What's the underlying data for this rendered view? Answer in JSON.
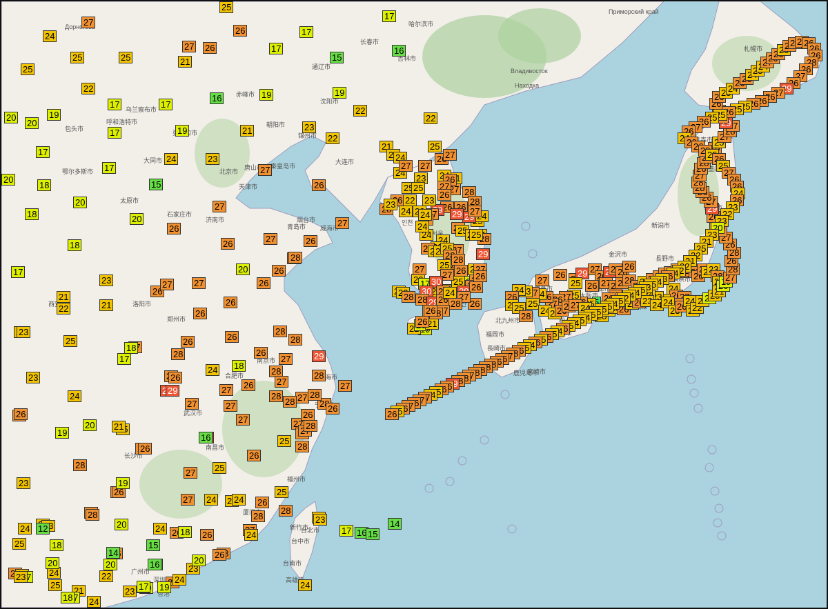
{
  "map": {
    "colors": {
      "sea": "#aad3df",
      "land": "#f2efe9",
      "forest": "#add19e",
      "border": "#9e9cbf"
    },
    "place_labels": [
      "Дорноговь",
      "乌兰察布市",
      "呼和浩特市",
      "包头市",
      "鄂尔多斯市",
      "大同市",
      "张家口市",
      "北京市",
      "天津市",
      "唐山市",
      "秦皇岛市",
      "石家庄市",
      "太原市",
      "济南市",
      "青岛市",
      "威海市",
      "烟台市",
      "沈阳市",
      "大连市",
      "长春市",
      "哈尔滨市",
      "吉林市",
      "通辽市",
      "赤峰市",
      "朝阳市",
      "锦州市",
      "郑州市",
      "洛阳市",
      "西安市",
      "武汉市",
      "南京市",
      "上海市",
      "杭州市",
      "宁波市",
      "合肥市",
      "南昌市",
      "长沙市",
      "福州市",
      "厦门市",
      "广州市",
      "深圳市",
      "香港",
      "台北市",
      "台中市",
      "高雄市",
      "台南市",
      "新竹市",
      "平壤",
      "서울",
      "부산",
      "대구",
      "광주",
      "인천",
      "제주",
      "Владивосток",
      "Находка",
      "Приморский край",
      "福岡市",
      "北九州市",
      "広島市",
      "大阪市",
      "京都市",
      "名古屋市",
      "東京",
      "横浜市",
      "仙台市",
      "札幌市",
      "新潟市",
      "金沢市",
      "長野市",
      "静岡市",
      "浜松市",
      "松山市",
      "高知市",
      "鹿児島市",
      "長崎市",
      "熊本市",
      "宮崎市",
      "青森市",
      "盛岡市"
    ],
    "temperatures": [
      {
        "v": "14"
      },
      {
        "v": "19"
      },
      {
        "v": "19"
      },
      {
        "v": "22"
      },
      {
        "v": "22"
      },
      {
        "v": "20"
      },
      {
        "v": "21"
      },
      {
        "v": "16"
      },
      {
        "v": "17"
      },
      {
        "v": "17"
      },
      {
        "v": "17"
      },
      {
        "v": "15"
      },
      {
        "v": "17"
      },
      {
        "v": "17"
      },
      {
        "v": "16"
      },
      {
        "v": "19"
      },
      {
        "v": "19"
      },
      {
        "v": "20"
      },
      {
        "v": "19"
      },
      {
        "v": "17"
      },
      {
        "v": "21"
      },
      {
        "v": "23"
      },
      {
        "v": "22"
      },
      {
        "v": "22"
      },
      {
        "v": "16"
      },
      {
        "v": "21"
      },
      {
        "v": "20"
      },
      {
        "v": "17"
      },
      {
        "v": "19"
      },
      {
        "v": "22"
      },
      {
        "v": "24"
      },
      {
        "v": "17"
      },
      {
        "v": "20"
      },
      {
        "v": "18"
      },
      {
        "v": "17"
      },
      {
        "v": "15"
      },
      {
        "v": "23"
      },
      {
        "v": "27"
      },
      {
        "v": "26"
      },
      {
        "v": "21"
      },
      {
        "v": "20"
      },
      {
        "v": "18"
      },
      {
        "v": "17"
      },
      {
        "v": "18"
      },
      {
        "v": "20"
      },
      {
        "v": "26"
      },
      {
        "v": "27"
      },
      {
        "v": "26"
      },
      {
        "v": "27"
      },
      {
        "v": "26"
      },
      {
        "v": "27"
      },
      {
        "v": "28"
      },
      {
        "v": "17"
      },
      {
        "v": "23"
      },
      {
        "v": "21"
      },
      {
        "v": "22"
      },
      {
        "v": "28"
      },
      {
        "v": "26"
      },
      {
        "v": "24"
      },
      {
        "v": "27"
      },
      {
        "v": "26"
      },
      {
        "v": "27"
      },
      {
        "v": "26"
      },
      {
        "v": "23"
      },
      {
        "v": "29"
      },
      {
        "v": "24"
      },
      {
        "v": "26"
      },
      {
        "v": "28"
      },
      {
        "v": "28"
      },
      {
        "v": "26"
      },
      {
        "v": "29"
      },
      {
        "v": "23"
      },
      {
        "v": "27"
      },
      {
        "v": "26"
      },
      {
        "v": "28"
      },
      {
        "v": "28"
      },
      {
        "v": "27"
      },
      {
        "v": "28"
      },
      {
        "v": "25"
      },
      {
        "v": "29"
      },
      {
        "v": "27"
      },
      {
        "v": "27"
      },
      {
        "v": "28"
      },
      {
        "v": "26"
      },
      {
        "v": "28"
      },
      {
        "v": "27"
      },
      {
        "v": "28"
      },
      {
        "v": "26"
      },
      {
        "v": "30"
      },
      {
        "v": "29"
      },
      {
        "v": "27"
      },
      {
        "v": "28"
      },
      {
        "v": "27"
      },
      {
        "v": "25"
      },
      {
        "v": "26"
      },
      {
        "v": "28"
      },
      {
        "v": "27"
      },
      {
        "v": "24"
      },
      {
        "v": "27"
      },
      {
        "v": "24"
      },
      {
        "v": "24"
      },
      {
        "v": "23"
      },
      {
        "v": "26"
      },
      {
        "v": "26"
      },
      {
        "v": "28"
      },
      {
        "v": "28"
      },
      {
        "v": "26"
      },
      {
        "v": "25"
      },
      {
        "v": "27"
      },
      {
        "v": "26"
      },
      {
        "v": "28"
      },
      {
        "v": "24"
      },
      {
        "v": "27"
      },
      {
        "v": "26"
      },
      {
        "v": "28"
      },
      {
        "v": "28"
      },
      {
        "v": "27"
      },
      {
        "v": "27"
      },
      {
        "v": "25"
      },
      {
        "v": "26"
      },
      {
        "v": "26"
      },
      {
        "v": "28"
      },
      {
        "v": "26"
      },
      {
        "v": "24"
      },
      {
        "v": "28"
      },
      {
        "v": "29"
      },
      {
        "v": "26"
      },
      {
        "v": "27"
      },
      {
        "v": "26"
      },
      {
        "v": "26"
      },
      {
        "v": "25"
      },
      {
        "v": "28"
      },
      {
        "v": "25"
      },
      {
        "v": "22"
      },
      {
        "v": "25"
      },
      {
        "v": "24"
      },
      {
        "v": "27"
      },
      {
        "v": "27"
      },
      {
        "v": "26"
      },
      {
        "v": "26"
      },
      {
        "v": "28"
      },
      {
        "v": "26"
      },
      {
        "v": "26"
      },
      {
        "v": "26"
      },
      {
        "v": "27"
      },
      {
        "v": "24"
      },
      {
        "v": "23"
      },
      {
        "v": "24"
      },
      {
        "v": "24"
      },
      {
        "v": "23"
      },
      {
        "v": "19"
      },
      {
        "v": "15"
      },
      {
        "v": "22"
      },
      {
        "v": "18"
      },
      {
        "v": "20"
      },
      {
        "v": "18"
      },
      {
        "v": "20"
      },
      {
        "v": "19"
      },
      {
        "v": "23"
      },
      {
        "v": "18"
      },
      {
        "v": "20"
      },
      {
        "v": "17"
      },
      {
        "v": "21"
      },
      {
        "v": "23"
      },
      {
        "v": "25"
      },
      {
        "v": "25"
      },
      {
        "v": "24"
      },
      {
        "v": "21"
      },
      {
        "v": "23"
      },
      {
        "v": "24"
      },
      {
        "v": "24"
      },
      {
        "v": "20"
      },
      {
        "v": "21"
      },
      {
        "v": "19"
      },
      {
        "v": "16"
      },
      {
        "v": "17"
      },
      {
        "v": "17"
      },
      {
        "v": "18"
      },
      {
        "v": "20"
      },
      {
        "v": "20"
      },
      {
        "v": "18"
      },
      {
        "v": "20"
      },
      {
        "v": "14"
      },
      {
        "v": "16"
      },
      {
        "v": "12"
      },
      {
        "v": "15"
      },
      {
        "v": "17"
      },
      {
        "v": "16"
      },
      {
        "v": "15"
      },
      {
        "v": "14"
      },
      {
        "v": "17"
      },
      {
        "v": "19"
      },
      {
        "v": "22"
      },
      {
        "v": "20"
      },
      {
        "v": "21"
      },
      {
        "v": "24"
      },
      {
        "v": "23"
      },
      {
        "v": "22"
      },
      {
        "v": "16"
      },
      {
        "v": "17"
      },
      {
        "v": "21"
      },
      {
        "v": "25"
      },
      {
        "v": "27"
      },
      {
        "v": "26"
      },
      {
        "v": "20"
      },
      {
        "v": "24"
      },
      {
        "v": "25"
      },
      {
        "v": "26"
      },
      {
        "v": "27"
      },
      {
        "v": "24"
      },
      {
        "v": "23"
      },
      {
        "v": "24"
      },
      {
        "v": "28"
      },
      {
        "v": "24"
      },
      {
        "v": "23"
      },
      {
        "v": "25"
      },
      {
        "v": "28"
      },
      {
        "v": "28"
      },
      {
        "v": "25"
      },
      {
        "v": "25"
      },
      {
        "v": "24"
      },
      {
        "v": "25"
      },
      {
        "v": "24"
      },
      {
        "v": "24"
      },
      {
        "v": "26"
      },
      {
        "v": "26"
      },
      {
        "v": "29"
      },
      {
        "v": "27"
      },
      {
        "v": "27"
      },
      {
        "v": "24"
      },
      {
        "v": "23"
      },
      {
        "v": "24"
      },
      {
        "v": "26"
      },
      {
        "v": "25"
      },
      {
        "v": "23"
      },
      {
        "v": "24"
      },
      {
        "v": "22"
      },
      {
        "v": "25"
      },
      {
        "v": "23"
      },
      {
        "v": "24"
      },
      {
        "v": "28"
      },
      {
        "v": "23"
      },
      {
        "v": "21"
      },
      {
        "v": "25"
      },
      {
        "v": "24"
      },
      {
        "v": "27"
      },
      {
        "v": "27"
      },
      {
        "v": "26"
      },
      {
        "v": "27"
      },
      {
        "v": "25"
      },
      {
        "v": "27"
      },
      {
        "v": "21"
      },
      {
        "v": "24"
      },
      {
        "v": "28"
      },
      {
        "v": "26"
      },
      {
        "v": "28"
      },
      {
        "v": "26"
      },
      {
        "v": "27"
      },
      {
        "v": "26"
      },
      {
        "v": "29"
      },
      {
        "v": "28"
      },
      {
        "v": "25"
      },
      {
        "v": "29"
      },
      {
        "v": "29"
      },
      {
        "v": "26"
      },
      {
        "v": "27"
      },
      {
        "v": "26"
      },
      {
        "v": "28"
      },
      {
        "v": "28"
      },
      {
        "v": "27"
      },
      {
        "v": "25"
      },
      {
        "v": "27"
      },
      {
        "v": "30"
      },
      {
        "v": "30"
      },
      {
        "v": "28"
      },
      {
        "v": "29"
      },
      {
        "v": "27"
      },
      {
        "v": "26"
      },
      {
        "v": "24"
      },
      {
        "v": "29"
      },
      {
        "v": "26"
      },
      {
        "v": "26"
      },
      {
        "v": "27"
      },
      {
        "v": "28"
      },
      {
        "v": "27"
      },
      {
        "v": "28"
      },
      {
        "v": "27"
      },
      {
        "v": "28"
      },
      {
        "v": "26"
      },
      {
        "v": "26"
      },
      {
        "v": "27"
      },
      {
        "v": "26"
      },
      {
        "v": "27"
      },
      {
        "v": "29"
      },
      {
        "v": "27"
      },
      {
        "v": "26"
      },
      {
        "v": "29"
      },
      {
        "v": "27"
      },
      {
        "v": "26"
      },
      {
        "v": "26"
      },
      {
        "v": "25"
      },
      {
        "v": "26"
      },
      {
        "v": "27"
      },
      {
        "v": "28"
      },
      {
        "v": "26"
      },
      {
        "v": "28"
      },
      {
        "v": "27"
      },
      {
        "v": "25"
      },
      {
        "v": "26"
      },
      {
        "v": "28"
      },
      {
        "v": "27"
      },
      {
        "v": "26"
      },
      {
        "v": "28"
      },
      {
        "v": "27"
      },
      {
        "v": "28"
      },
      {
        "v": "27"
      },
      {
        "v": "26"
      },
      {
        "v": "27"
      },
      {
        "v": "25"
      },
      {
        "v": "23"
      },
      {
        "v": "28"
      },
      {
        "v": "25"
      },
      {
        "v": "24"
      },
      {
        "v": "26"
      },
      {
        "v": "27"
      },
      {
        "v": "26"
      },
      {
        "v": "24"
      },
      {
        "v": "23"
      },
      {
        "v": "24"
      },
      {
        "v": "19"
      },
      {
        "v": "18"
      },
      {
        "v": "26"
      },
      {
        "v": "27"
      },
      {
        "v": "26"
      },
      {
        "v": "5"
      },
      {
        "v": "25"
      },
      {
        "v": "26"
      },
      {
        "v": "25"
      },
      {
        "v": "27"
      },
      {
        "v": "26"
      },
      {
        "v": "27"
      },
      {
        "v": "26"
      },
      {
        "v": "24"
      },
      {
        "v": "27"
      },
      {
        "v": "23"
      },
      {
        "v": "24"
      },
      {
        "v": "26"
      },
      {
        "v": "24"
      },
      {
        "v": "25"
      },
      {
        "v": "28"
      },
      {
        "v": "25"
      },
      {
        "v": "24"
      },
      {
        "v": "25"
      },
      {
        "v": "26"
      },
      {
        "v": "26"
      },
      {
        "v": "27"
      },
      {
        "v": "24"
      },
      {
        "v": "24"
      },
      {
        "v": "25"
      },
      {
        "v": "24"
      },
      {
        "v": "25"
      },
      {
        "v": "26"
      },
      {
        "v": "24"
      },
      {
        "v": "26"
      },
      {
        "v": "23"
      },
      {
        "v": "24"
      },
      {
        "v": "24"
      },
      {
        "v": "23"
      },
      {
        "v": "26"
      },
      {
        "v": "24"
      },
      {
        "v": "25"
      },
      {
        "v": "22"
      },
      {
        "v": "23"
      },
      {
        "v": "20"
      },
      {
        "v": "25"
      },
      {
        "v": "21"
      },
      {
        "v": "20"
      },
      {
        "v": "19"
      },
      {
        "v": "27"
      },
      {
        "v": "28"
      },
      {
        "v": "26"
      },
      {
        "v": "28"
      },
      {
        "v": "26"
      },
      {
        "v": "27"
      },
      {
        "v": "27"
      },
      {
        "v": "26"
      },
      {
        "v": "26"
      },
      {
        "v": "29"
      },
      {
        "v": "27"
      },
      {
        "v": "26"
      },
      {
        "v": "26"
      },
      {
        "v": "28"
      },
      {
        "v": "28"
      },
      {
        "v": "27"
      },
      {
        "v": "26"
      },
      {
        "v": "28"
      },
      {
        "v": "27"
      },
      {
        "v": "26"
      },
      {
        "v": "28"
      },
      {
        "v": "25"
      },
      {
        "v": "27"
      },
      {
        "v": "28"
      },
      {
        "v": "27"
      },
      {
        "v": "29"
      },
      {
        "v": "26"
      },
      {
        "v": "27"
      },
      {
        "v": "26"
      },
      {
        "v": "26"
      },
      {
        "v": "25"
      },
      {
        "v": "24"
      },
      {
        "v": "26"
      },
      {
        "v": "26"
      },
      {
        "v": "24"
      },
      {
        "v": "25"
      },
      {
        "v": "24"
      },
      {
        "v": "27"
      },
      {
        "v": "26"
      },
      {
        "v": "26"
      },
      {
        "v": "25"
      },
      {
        "v": "28"
      },
      {
        "v": "27"
      },
      {
        "v": "28"
      },
      {
        "v": "26"
      },
      {
        "v": "26"
      },
      {
        "v": "26"
      },
      {
        "v": "28"
      },
      {
        "v": "26"
      },
      {
        "v": "27"
      },
      {
        "v": "26"
      },
      {
        "v": "29"
      },
      {
        "v": "27"
      },
      {
        "v": "26"
      },
      {
        "v": "26"
      },
      {
        "v": "26"
      },
      {
        "v": "25"
      },
      {
        "v": "25"
      },
      {
        "v": "26"
      },
      {
        "v": "25"
      },
      {
        "v": "25"
      },
      {
        "v": "26"
      },
      {
        "v": "27"
      },
      {
        "v": "26"
      },
      {
        "v": "24"
      },
      {
        "v": "26"
      },
      {
        "v": "26"
      },
      {
        "v": "28"
      },
      {
        "v": "25"
      },
      {
        "v": "26"
      },
      {
        "v": "25"
      },
      {
        "v": "27"
      },
      {
        "v": "26"
      },
      {
        "v": "26"
      },
      {
        "v": "24"
      },
      {
        "v": "26"
      },
      {
        "v": "23"
      },
      {
        "v": "22"
      },
      {
        "v": "23"
      },
      {
        "v": "20"
      },
      {
        "v": "23"
      },
      {
        "v": "21"
      },
      {
        "v": "25"
      },
      {
        "v": "22"
      },
      {
        "v": "21"
      },
      {
        "v": "22"
      },
      {
        "v": "22"
      },
      {
        "v": "24"
      },
      {
        "v": "26"
      },
      {
        "v": "23"
      },
      {
        "v": "24"
      },
      {
        "v": "25"
      },
      {
        "v": "23"
      },
      {
        "v": "25"
      },
      {
        "v": "24"
      },
      {
        "v": "24"
      },
      {
        "v": "22"
      },
      {
        "v": "25"
      },
      {
        "v": "24"
      },
      {
        "v": "25"
      },
      {
        "v": "25"
      },
      {
        "v": "25"
      },
      {
        "v": "25"
      },
      {
        "v": "24"
      },
      {
        "v": "25"
      },
      {
        "v": "24"
      },
      {
        "v": "25"
      },
      {
        "v": "26"
      },
      {
        "v": "24"
      },
      {
        "v": "25"
      },
      {
        "v": "26"
      },
      {
        "v": "25"
      },
      {
        "v": "26"
      },
      {
        "v": "24"
      },
      {
        "v": "25"
      },
      {
        "v": "26"
      },
      {
        "v": "28"
      },
      {
        "v": "27"
      },
      {
        "v": "26"
      },
      {
        "v": "26"
      },
      {
        "v": "28"
      },
      {
        "v": "28"
      },
      {
        "v": "28"
      },
      {
        "v": "28"
      },
      {
        "v": "27"
      },
      {
        "v": "28"
      },
      {
        "v": "28"
      },
      {
        "v": "29"
      },
      {
        "v": "26"
      },
      {
        "v": "26"
      },
      {
        "v": "25"
      },
      {
        "v": "24"
      },
      {
        "v": "27"
      },
      {
        "v": "27"
      },
      {
        "v": "26"
      },
      {
        "v": "27"
      },
      {
        "v": "26"
      },
      {
        "v": "25"
      },
      {
        "v": "26"
      },
      {
        "v": "25"
      },
      {
        "v": "27"
      },
      {
        "v": "24"
      },
      {
        "v": "25"
      },
      {
        "v": "25"
      },
      {
        "v": "25"
      },
      {
        "v": "22"
      },
      {
        "v": "26"
      },
      {
        "v": "27"
      },
      {
        "v": "26"
      }
    ]
  }
}
